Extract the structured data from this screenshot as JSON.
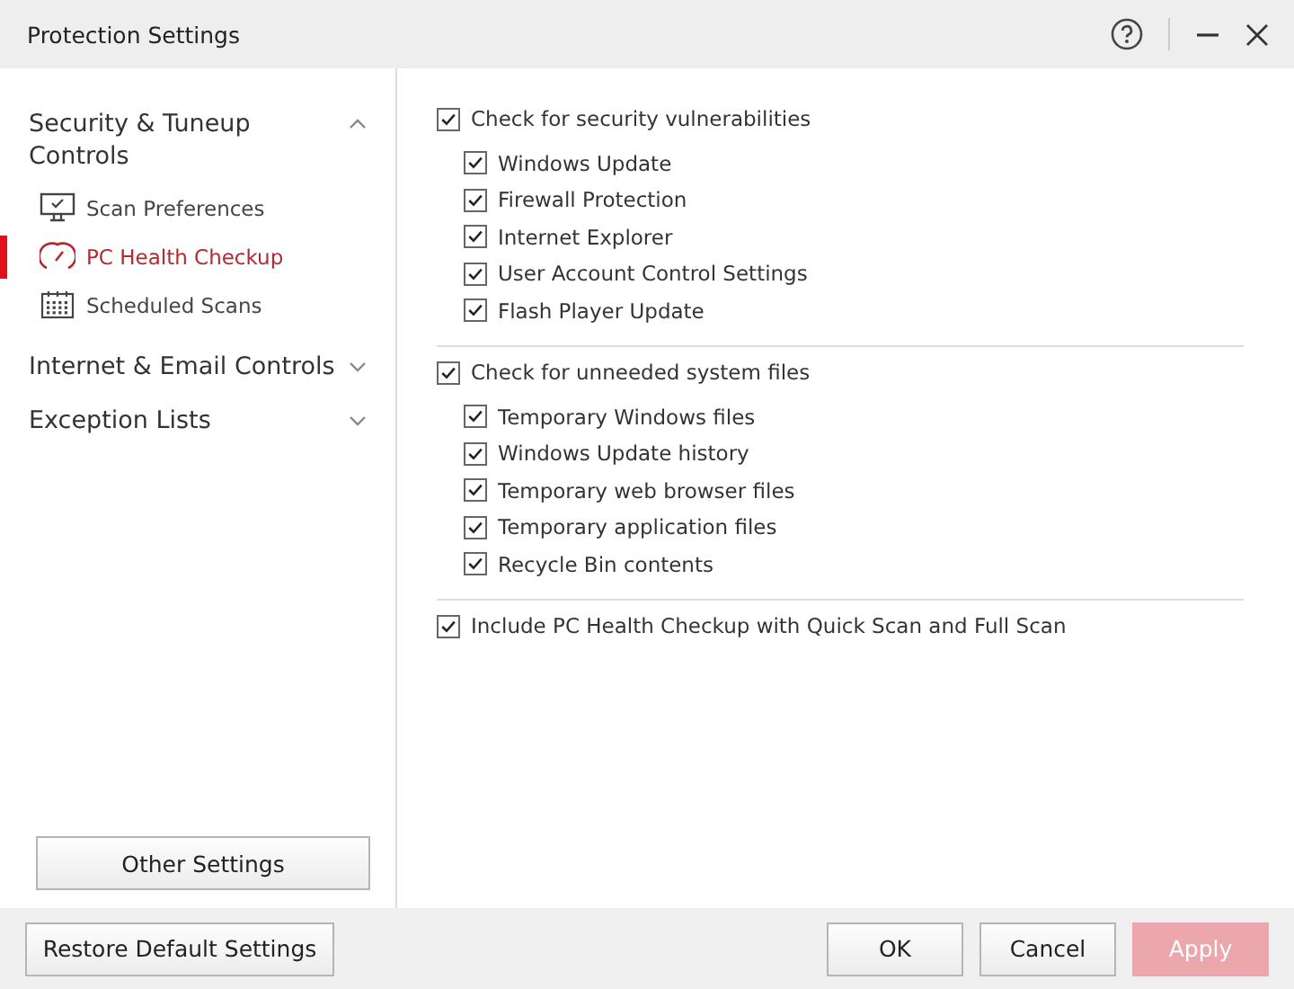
{
  "window": {
    "title": "Protection Settings"
  },
  "sidebar": {
    "sections": [
      {
        "label": "Security & Tuneup Controls",
        "expanded": true,
        "children": [
          {
            "label": "Scan Preferences",
            "kind": "monitor",
            "selected": false
          },
          {
            "label": "PC Health Checkup",
            "kind": "gauge",
            "selected": true
          },
          {
            "label": "Scheduled Scans",
            "kind": "calendar",
            "selected": false
          }
        ]
      },
      {
        "label": "Internet & Email Controls",
        "expanded": false
      },
      {
        "label": "Exception Lists",
        "expanded": false
      }
    ],
    "other_button": "Other Settings"
  },
  "groups": [
    {
      "label": "Check for security vulnerabilities",
      "checked": true,
      "items": [
        {
          "label": "Windows Update",
          "checked": true
        },
        {
          "label": "Firewall Protection",
          "checked": true
        },
        {
          "label": "Internet Explorer",
          "checked": true
        },
        {
          "label": "User Account Control Settings",
          "checked": true
        },
        {
          "label": "Flash Player Update",
          "checked": true
        }
      ]
    },
    {
      "label": "Check for unneeded system files",
      "checked": true,
      "items": [
        {
          "label": "Temporary Windows files",
          "checked": true
        },
        {
          "label": "Windows Update history",
          "checked": true
        },
        {
          "label": "Temporary web browser files",
          "checked": true
        },
        {
          "label": "Temporary application files",
          "checked": true
        },
        {
          "label": "Recycle Bin contents",
          "checked": true
        }
      ]
    },
    {
      "label": "Include PC Health Checkup with Quick Scan and Full Scan",
      "checked": true
    }
  ],
  "footer": {
    "restore": "Restore Default Settings",
    "buttons": [
      {
        "label": "OK",
        "disabled": false
      },
      {
        "label": "Cancel",
        "disabled": false
      },
      {
        "label": "Apply",
        "disabled": true
      }
    ]
  }
}
